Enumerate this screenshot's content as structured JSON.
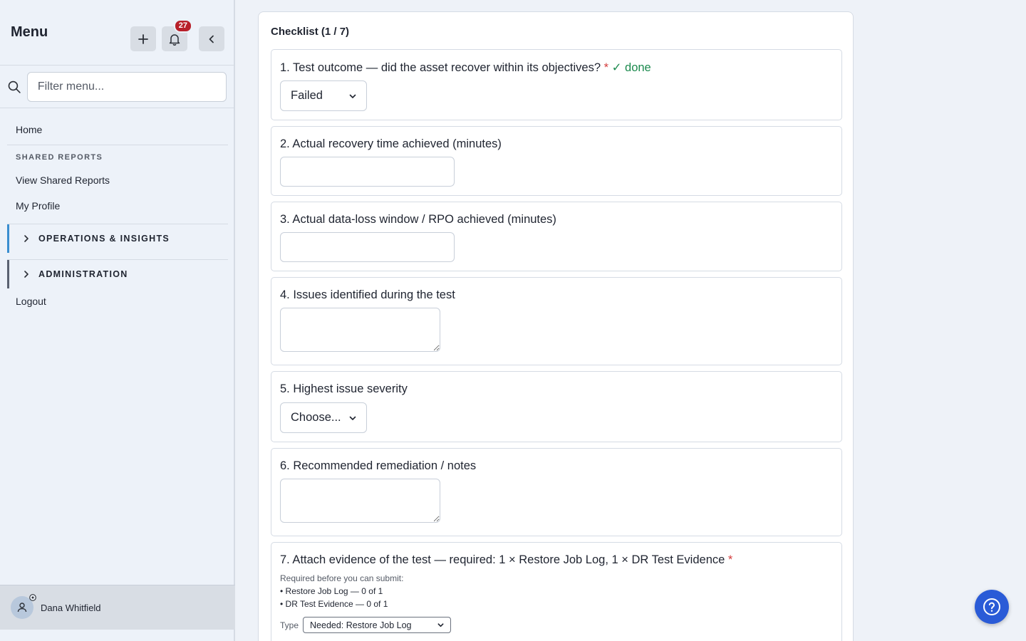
{
  "sidebar": {
    "title": "Menu",
    "notification_count": "27",
    "search_placeholder": "Filter menu...",
    "home": "Home",
    "shared_section": "SHARED REPORTS",
    "view_shared": "View Shared Reports",
    "my_profile": "My Profile",
    "group_ops": "OPERATIONS & INSIGHTS",
    "group_admin": "ADMINISTRATION",
    "logout": "Logout",
    "user_name": "Dana Whitfield",
    "colors": {
      "ops_accent": "#3a8ed0",
      "badge": "#b8202a"
    }
  },
  "checklist": {
    "title": "Checklist (1 / 7)",
    "q1": {
      "label": "1. Test outcome — did the asset recover within its objectives?",
      "required_mark": "*",
      "done_text": "✓ done",
      "selected": "Failed"
    },
    "q2": {
      "label": "2. Actual recovery time achieved (minutes)"
    },
    "q3": {
      "label": "3. Actual data-loss window / RPO achieved (minutes)"
    },
    "q4": {
      "label": "4. Issues identified during the test"
    },
    "q5": {
      "label": "5. Highest issue severity",
      "selected": "Choose..."
    },
    "q6": {
      "label": "6. Recommended remediation / notes"
    },
    "q7": {
      "label": "7. Attach evidence of the test — required: 1 × Restore Job Log, 1 × DR Test Evidence",
      "required_mark": "*",
      "required_note": "Required before you can submit:",
      "req_items": [
        "• Restore Job Log — 0 of 1",
        "• DR Test Evidence — 0 of 1"
      ],
      "type_label": "Type",
      "type_selected": "Needed: Restore Job Log"
    }
  },
  "help_icon": "question-circle-icon"
}
